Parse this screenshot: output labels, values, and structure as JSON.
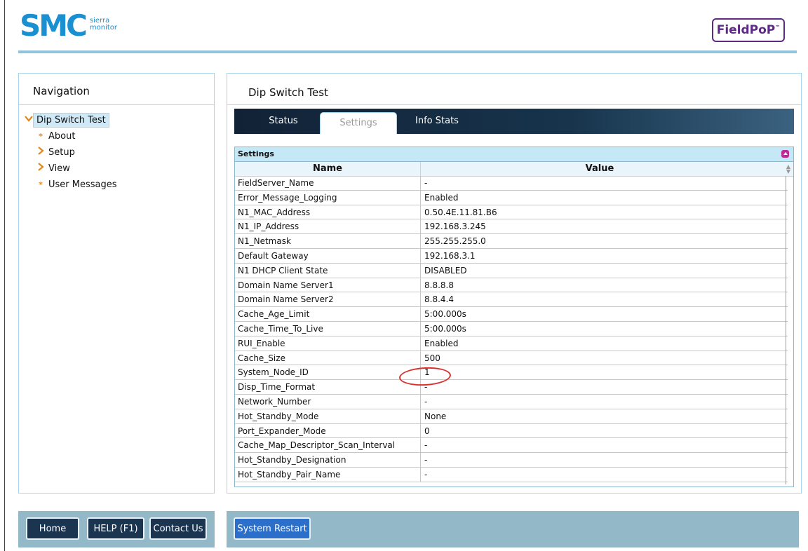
{
  "header": {
    "brand_main": "SMC",
    "brand_sub_line1": "sierra",
    "brand_sub_line2": "monitor",
    "product_logo": "FieldPoP",
    "product_logo_tm": "™"
  },
  "navigation": {
    "title": "Navigation",
    "items": [
      {
        "label": "Dip Switch Test",
        "icon": "chevron-down-icon"
      },
      {
        "label": "About",
        "icon": "bullet-icon"
      },
      {
        "label": "Setup",
        "icon": "chevron-right-icon"
      },
      {
        "label": "View",
        "icon": "chevron-right-icon"
      },
      {
        "label": "User Messages",
        "icon": "bullet-icon"
      }
    ]
  },
  "main": {
    "title": "Dip Switch Test",
    "tabs": [
      {
        "label": "Status"
      },
      {
        "label": "Settings"
      },
      {
        "label": "Info Stats"
      }
    ],
    "active_tab": "Settings",
    "grid": {
      "caption": "Settings",
      "columns": [
        "Name",
        "Value"
      ],
      "rows": [
        [
          "FieldServer_Name",
          "-"
        ],
        [
          "Error_Message_Logging",
          "Enabled"
        ],
        [
          "N1_MAC_Address",
          "0.50.4E.11.81.B6"
        ],
        [
          "N1_IP_Address",
          "192.168.3.245"
        ],
        [
          "N1_Netmask",
          "255.255.255.0"
        ],
        [
          "Default Gateway",
          "192.168.3.1"
        ],
        [
          "N1 DHCP Client State",
          "DISABLED"
        ],
        [
          "Domain Name Server1",
          "8.8.8.8"
        ],
        [
          "Domain Name Server2",
          "8.8.4.4"
        ],
        [
          "Cache_Age_Limit",
          "5:00.000s"
        ],
        [
          "Cache_Time_To_Live",
          "5:00.000s"
        ],
        [
          "RUI_Enable",
          "Enabled"
        ],
        [
          "Cache_Size",
          "500"
        ],
        [
          "System_Node_ID",
          "1"
        ],
        [
          "Disp_Time_Format",
          "-"
        ],
        [
          "Network_Number",
          "-"
        ],
        [
          "Hot_Standby_Mode",
          "None"
        ],
        [
          "Port_Expander_Mode",
          "0"
        ],
        [
          "Cache_Map_Descriptor_Scan_Interval",
          "-"
        ],
        [
          "Hot_Standby_Designation",
          "-"
        ],
        [
          "Hot_Standby_Pair_Name",
          "-"
        ]
      ]
    }
  },
  "footer": {
    "home_label": "Home",
    "help_label": "HELP (F1)",
    "contact_label": "Contact Us",
    "restart_label": "System Restart"
  },
  "colors": {
    "brand_blue": "#1a8fd1",
    "brand_purple": "#5d2a86",
    "tabbar_dark": "#122236",
    "footer_bar": "#93b9c9",
    "highlight": "#d9322d"
  }
}
